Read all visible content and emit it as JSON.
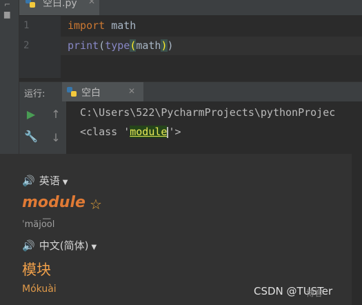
{
  "editor": {
    "tab_label": "空白.py",
    "lines": [
      {
        "num": "1",
        "keyword": "import",
        "rest": " math"
      },
      {
        "num": "2",
        "func": "print",
        "paren_open": "(",
        "inner_func": "type",
        "inner_open": "(",
        "arg": "math",
        "inner_close": ")",
        "paren_close": ")"
      }
    ]
  },
  "run": {
    "label": "运行:",
    "tab_label": "空白",
    "console_lines": [
      "C:\\Users\\522\\PycharmProjects\\pythonProjec",
      {
        "prefix": "<class '",
        "word": "module",
        "suffix": "'>"
      }
    ]
  },
  "dictionary": {
    "source_lang": "英语",
    "headword": "module",
    "phonetic": "ˈmäjo͞ol",
    "target_lang": "中文(简体)",
    "translation": "模块",
    "pinyin": "Mókuài"
  },
  "watermark": {
    "text": "CSDN @TUSTer",
    "suffix": "博客"
  },
  "colors": {
    "accent_orange": "#e07a35",
    "keyword": "#cc7832",
    "builtin": "#8888c6",
    "run_green": "#499c54"
  }
}
